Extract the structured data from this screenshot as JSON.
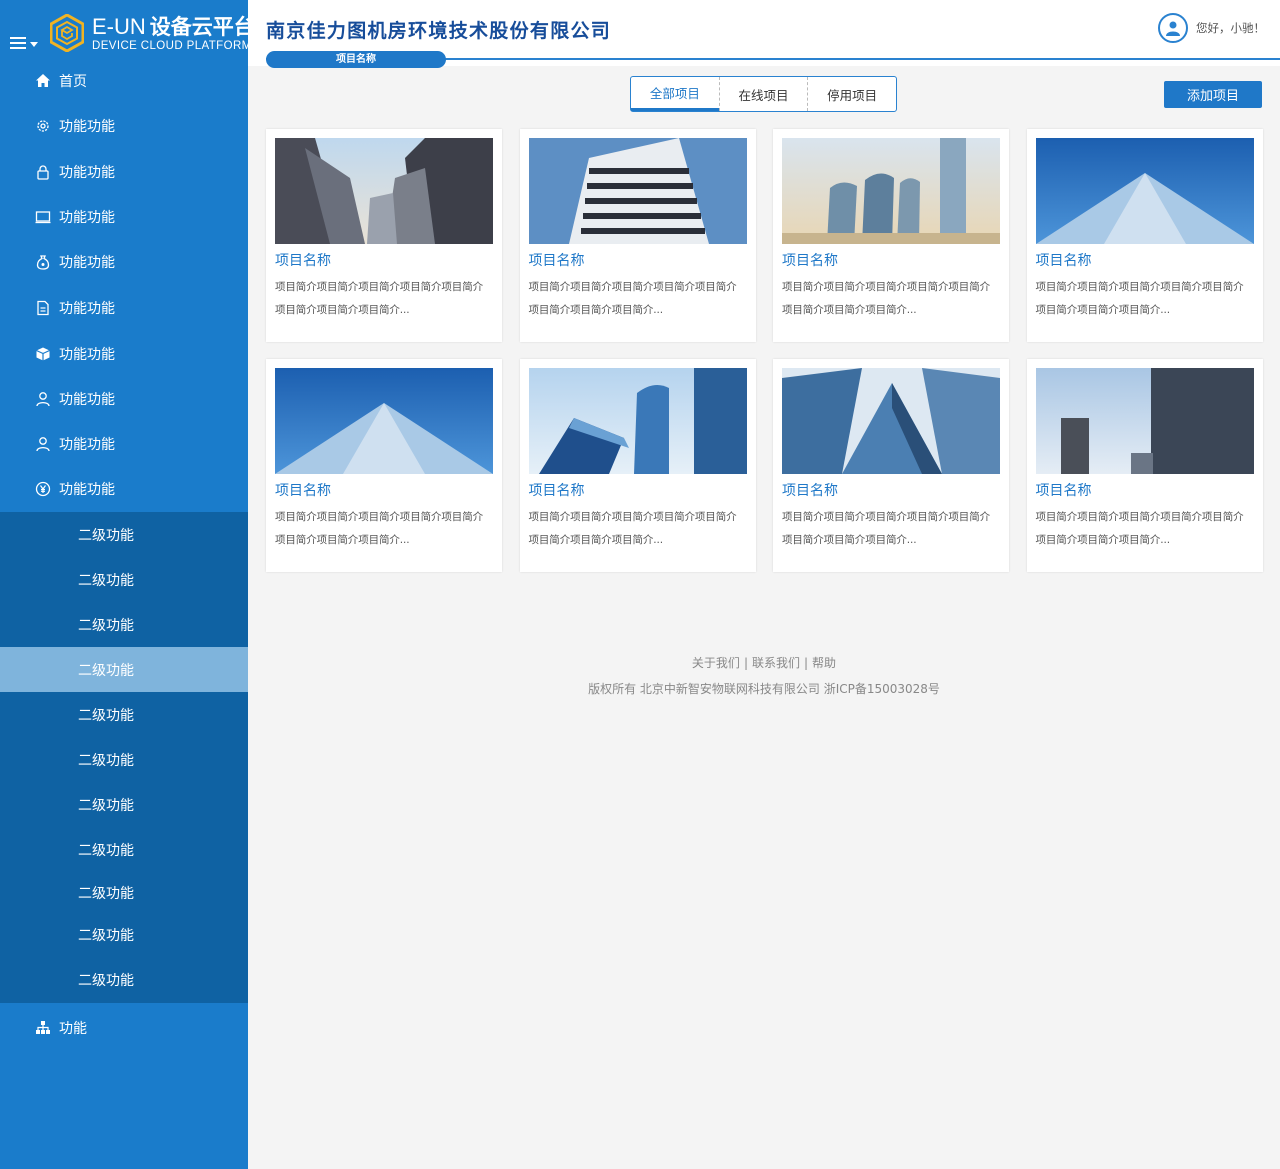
{
  "brand": {
    "logo_en": "E-UN",
    "logo_cn": "设备云平台",
    "tagline": "DEVICE CLOUD PLATFORM"
  },
  "nav": {
    "items": [
      {
        "label": "首页",
        "icon": "home-icon"
      },
      {
        "label": "功能功能",
        "icon": "gear-icon"
      },
      {
        "label": "功能功能",
        "icon": "lock-icon"
      },
      {
        "label": "功能功能",
        "icon": "monitor-icon"
      },
      {
        "label": "功能功能",
        "icon": "money-bag-icon"
      },
      {
        "label": "功能功能",
        "icon": "document-icon"
      },
      {
        "label": "功能功能",
        "icon": "box-icon"
      },
      {
        "label": "功能功能",
        "icon": "user-icon"
      },
      {
        "label": "功能功能",
        "icon": "user-icon"
      },
      {
        "label": "功能功能",
        "icon": "yen-icon"
      }
    ],
    "sub_items": [
      {
        "label": "二级功能"
      },
      {
        "label": "二级功能"
      },
      {
        "label": "二级功能"
      },
      {
        "label": "二级功能",
        "active": true
      },
      {
        "label": "二级功能"
      },
      {
        "label": "二级功能"
      },
      {
        "label": "二级功能"
      },
      {
        "label": "二级功能"
      },
      {
        "label": "二级功能"
      },
      {
        "label": "二级功能"
      },
      {
        "label": "二级功能"
      }
    ],
    "last_item": {
      "label": "功能",
      "icon": "sitemap-icon"
    }
  },
  "header": {
    "company": "南京佳力图机房环境技术股份有限公司",
    "breadcrumb": "项目名称",
    "greeting": "您好，小驰！"
  },
  "toolbar": {
    "tabs": [
      "全部项目",
      "在线项目",
      "停用项目"
    ],
    "active_tab": 0,
    "add_label": "添加项目"
  },
  "projects": [
    {
      "name": "项目名称",
      "desc1": "项目简介项目简介项目简介项目简介项目简介",
      "desc2": "项目简介项目简介项目简介..."
    },
    {
      "name": "项目名称",
      "desc1": "项目简介项目简介项目简介项目简介项目简介",
      "desc2": "项目简介项目简介项目简介..."
    },
    {
      "name": "项目名称",
      "desc1": "项目简介项目简介项目简介项目简介项目简介",
      "desc2": "项目简介项目简介项目简介..."
    },
    {
      "name": "项目名称",
      "desc1": "项目简介项目简介项目简介项目简介项目简介",
      "desc2": "项目简介项目简介项目简介..."
    },
    {
      "name": "项目名称",
      "desc1": "项目简介项目简介项目简介项目简介项目简介",
      "desc2": "项目简介项目简介项目简介..."
    },
    {
      "name": "项目名称",
      "desc1": "项目简介项目简介项目简介项目简介项目简介",
      "desc2": "项目简介项目简介项目简介..."
    },
    {
      "name": "项目名称",
      "desc1": "项目简介项目简介项目简介项目简介项目简介",
      "desc2": "项目简介项目简介项目简介..."
    },
    {
      "name": "项目名称",
      "desc1": "项目简介项目简介项目简介项目简介项目简介",
      "desc2": "项目简介项目简介项目简介..."
    }
  ],
  "footer": {
    "about": "关于我们",
    "contact": "联系我们",
    "help": "帮助",
    "separator": "|",
    "copyright": "版权所有  北京中新智安物联网科技有限公司 浙ICP备15003028号"
  },
  "colors": {
    "sidebar": "#1a7ccb",
    "sub_menu": "#0f62a3",
    "sub_active": "#7fb4dc",
    "accent": "#1f78c8",
    "company_text": "#174d9a"
  }
}
